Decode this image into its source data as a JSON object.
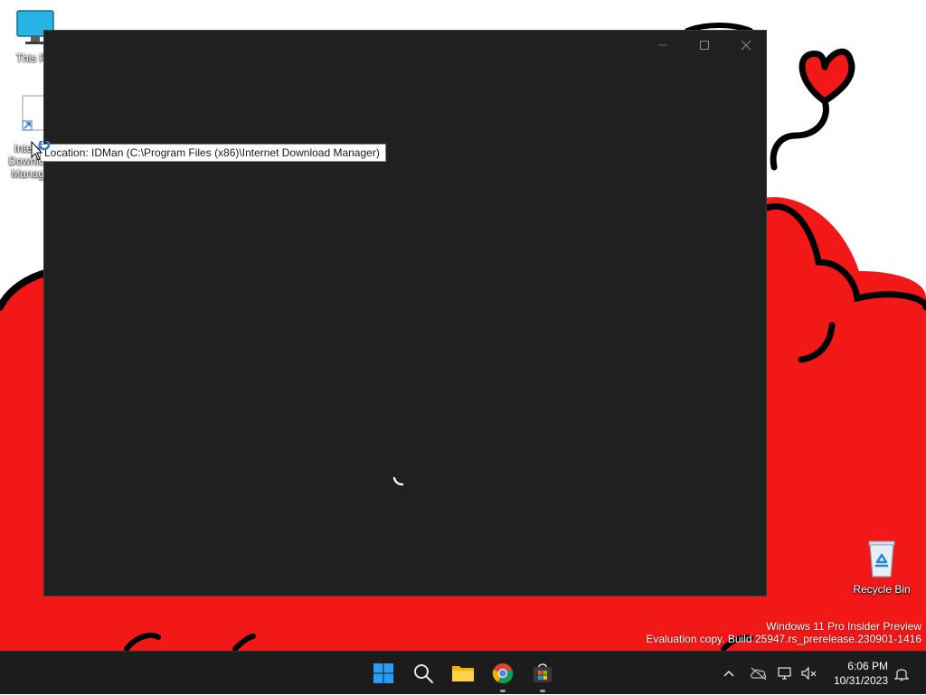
{
  "desktop": {
    "icons": [
      {
        "label": "This PC",
        "icon": "monitor-icon"
      },
      {
        "label": "Internet Download Manager",
        "icon": "idm-shortcut-icon"
      },
      {
        "label": "Recycle Bin",
        "icon": "recycle-bin-icon"
      }
    ],
    "watermark": {
      "line1": "Windows 11 Pro Insider Preview",
      "line2": "Evaluation copy. Build 25947.rs_prerelease.230901-1416"
    }
  },
  "tooltip": {
    "text": "Location: IDMan (C:\\Program Files (x86)\\Internet Download Manager)"
  },
  "window": {
    "state": "loading",
    "buttons": {
      "minimize": "minimize-icon",
      "maximize": "maximize-icon",
      "close": "close-icon"
    }
  },
  "taskbar": {
    "apps": [
      {
        "name": "Start",
        "icon": "windows-logo-icon"
      },
      {
        "name": "Search",
        "icon": "search-icon"
      },
      {
        "name": "File Explorer",
        "icon": "folder-icon"
      },
      {
        "name": "Google Chrome",
        "icon": "chrome-icon",
        "running": true
      },
      {
        "name": "Microsoft Store",
        "icon": "store-icon",
        "running": true
      }
    ],
    "tray": {
      "time": "6:06 PM",
      "date": "10/31/2023"
    }
  },
  "colors": {
    "wallpaper_red": "#f21818",
    "window_bg": "#202020",
    "taskbar_bg": "#1c1c1c",
    "accent": "#0078d4"
  }
}
